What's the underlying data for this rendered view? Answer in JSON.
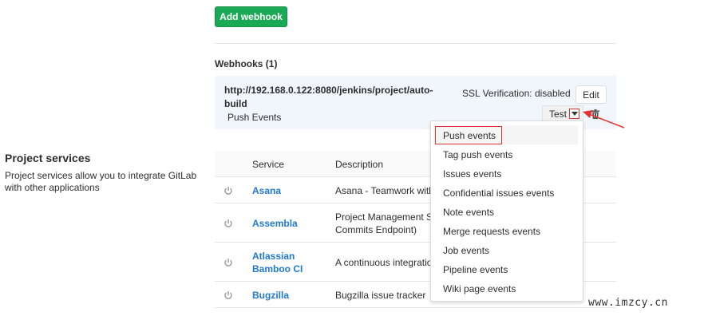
{
  "add_webhook": {
    "label": "Add webhook"
  },
  "webhooks": {
    "heading": "Webhooks (1)",
    "items": [
      {
        "url": "http://192.168.0.122:8080/jenkins/project/auto-build",
        "events": "Push Events",
        "ssl": "SSL Verification: disabled",
        "edit_label": "Edit",
        "test_label": "Test"
      }
    ]
  },
  "project_services": {
    "title": "Project services",
    "description": "Project services allow you to integrate GitLab with other applications"
  },
  "services_table": {
    "headers": {
      "service": "Service",
      "description": "Description"
    },
    "rows": [
      {
        "name": "Asana",
        "description": "Asana - Teamwork with"
      },
      {
        "name": "Assembla",
        "description": "Project Management S\nCommits Endpoint)"
      },
      {
        "name": "Atlassian Bamboo CI",
        "description": "A continuous integratio"
      },
      {
        "name": "Bugzilla",
        "description": "Bugzilla issue tracker"
      }
    ]
  },
  "test_dropdown": {
    "items": [
      "Push events",
      "Tag push events",
      "Issues events",
      "Confidential issues events",
      "Note events",
      "Merge requests events",
      "Job events",
      "Pipeline events",
      "Wiki page events"
    ]
  },
  "watermark": "www.imzcy.cn",
  "colors": {
    "primary_green": "#1aaa55",
    "link_blue": "#1f78d1",
    "annotation_red": "#e53333"
  }
}
